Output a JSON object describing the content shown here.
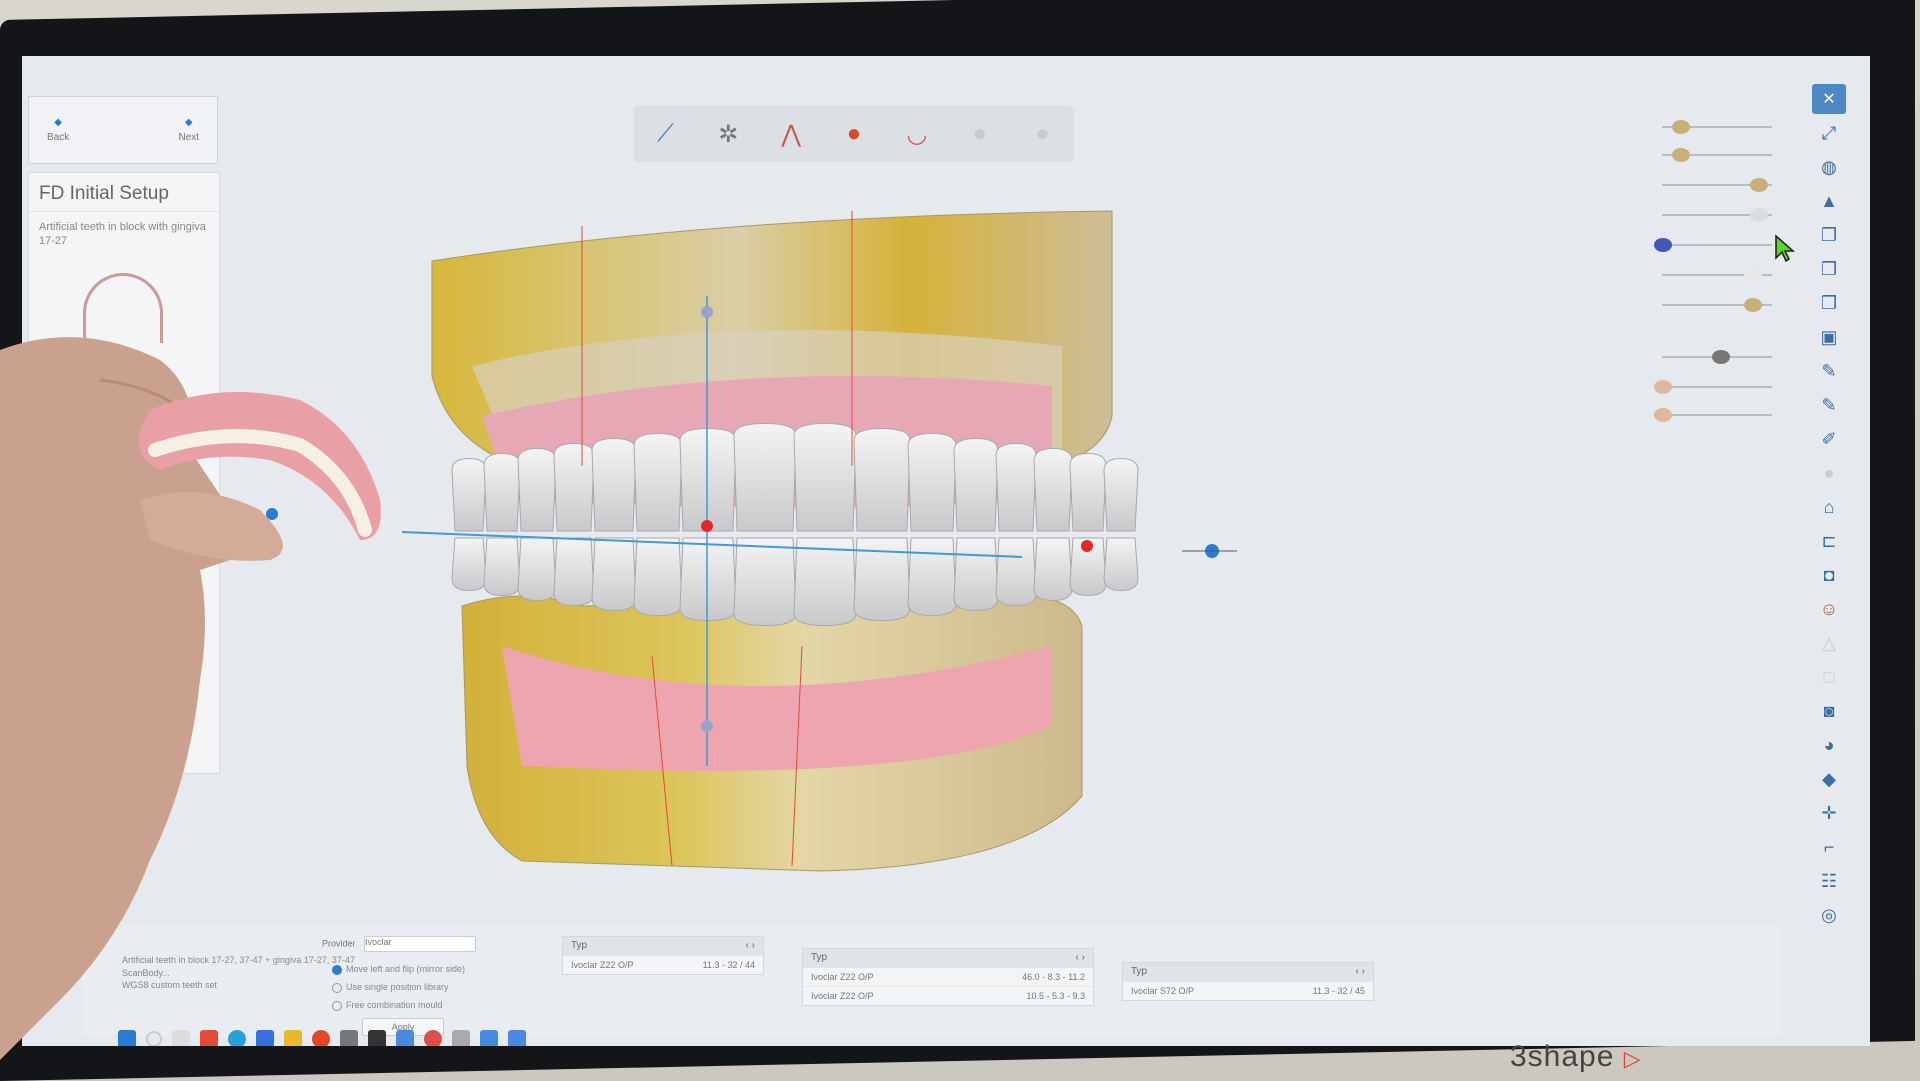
{
  "app": {
    "nav": {
      "back_label": "Back",
      "next_label": "Next"
    },
    "wizard": {
      "title": "FD Initial Setup",
      "description": "Artificial teeth in block with gingiva 17-27"
    },
    "toolbar": {
      "tools": [
        "knife-tool-icon",
        "bone-tool-icon",
        "gingiva-tool-icon",
        "color-tool-icon",
        "denture-tool-icon",
        "sphere-icon",
        "sphere-icon"
      ]
    },
    "bottom": {
      "info_lines": [
        "Artificial teeth in block 17-27, 37-47 + gingiva 17-27, 37-47",
        "ScanBody...",
        "WGS8 custom teeth set"
      ],
      "provider_label": "Provider",
      "provider_value": "Ivoclar",
      "options": [
        "Move left and flip (mirror side)",
        "Use single position library",
        "Free combination mould"
      ],
      "apply_label": "Apply",
      "panels": [
        {
          "header": "Typ",
          "rows": [
            [
              "Ivoclar Z22 O/P",
              "11.3 - 32 / 44"
            ]
          ]
        },
        {
          "header": "Typ",
          "rows": [
            [
              "Ivoclar Z22 O/P",
              "46.0 - 8.3 - 11.2"
            ],
            [
              "Ivoclar Z22 O/P",
              "10.5 - 5.3 - 9.3"
            ]
          ]
        },
        {
          "header": "Typ",
          "rows": [
            [
              "Ivoclar S72 O/P",
              "11.3 - 32 / 45"
            ]
          ]
        }
      ]
    },
    "brand": "3shape"
  },
  "colors": {
    "screen_bg": "#e6e9ed",
    "model_stone": "#d8c24a",
    "gingiva": "#e8a7b4",
    "teeth": "#e9e9ea",
    "axis_blue": "#2d7bd1",
    "axis_red": "#e02a2a",
    "brand_accent": "#e2442f"
  }
}
